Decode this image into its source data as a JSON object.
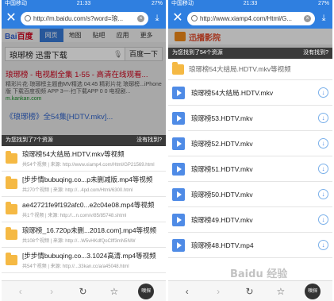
{
  "left": {
    "status": {
      "signal": "中国移动",
      "time": "21:33",
      "battery": "27%"
    },
    "url": "http://m.baidu.com/s?word=琅...",
    "baidu": {
      "logo_a": "Bai",
      "logo_b": "百度",
      "tabs": [
        "网页",
        "地图",
        "贴吧",
        "应用",
        "更多"
      ],
      "query": "琅琊榜 迅雷下载",
      "search_btn": "百度一下",
      "result1_title": "琅琊榜 - 电视剧全集 1-55 - 高清在线观看...",
      "result1_desc": "精彩片花·琅琊榜主题曲MV精选 04:45 精彩片花 琅琊榜...iPhone版 下载百度视频 APP 3一·扫下载APP 0 0 电视剧...",
      "result1_url": "m.kankan.com",
      "result2_title": "《琅琊榜》全54集[HDTV.mkv]..."
    },
    "sheet": {
      "found": "为您找到了7个资源",
      "not_found": "没有找到?"
    },
    "items": [
      {
        "title": "琅琊榜54大结局.HDTV.mkv等视频",
        "source": "共54个视频 | 来源: http://www.xiamp4.com/Html/GP21569.html"
      },
      {
        "title": "[步步情bubuqing.co...p未删减版.mp4等视频",
        "source": "共270个视频 | 来源: http://...4pd.com/Html/6300.html"
      },
      {
        "title": "ae42721fe9f192afc0...e2c04e08.mp4等视频",
        "source": "共1个视频 | 来源: http://...n.com/v/85/85748.shtml"
      },
      {
        "title": "琅琊榜_16.720p未删...2018.com].mp4等视频",
        "source": "共108个视频 | 来源: http://...W5vHKdfQoClff3mN5NW"
      },
      {
        "title": "[步步情bubuqing.co...3.1024高清.mp4等视频",
        "source": "共54个视频 | 来源: http://...33kan.cc/a/a45048.html"
      }
    ],
    "toolbar": {
      "back": "‹",
      "forward": "›",
      "refresh": "↻",
      "favorite": "☆",
      "sniff": "嗅探"
    }
  },
  "right": {
    "status": {
      "signal": "中国移动",
      "time": "21:33",
      "battery": "27%"
    },
    "url": "http://www.xiamp4.com/Html/G...",
    "site_name": "迅播影院",
    "sheet": {
      "found": "为您找到了54个资源",
      "not_found": "没有找到?"
    },
    "folder": "琅琊榜54大结局.HDTV.mkv等视频",
    "items": [
      "琅琊榜54大结局.HDTV.mkv",
      "琅琊榜53.HDTV.mkv",
      "琅琊榜52.HDTV.mkv",
      "琅琊榜51.HDTV.mkv",
      "琅琊榜50.HDTV.mkv",
      "琅琊榜49.HDTV.mkv",
      "琅琊榜48.HDTV.mp4"
    ],
    "toolbar": {
      "back": "‹",
      "forward": "›",
      "refresh": "↻",
      "favorite": "☆",
      "sniff": "嗅探"
    }
  },
  "watermark": "Baidu 经验"
}
